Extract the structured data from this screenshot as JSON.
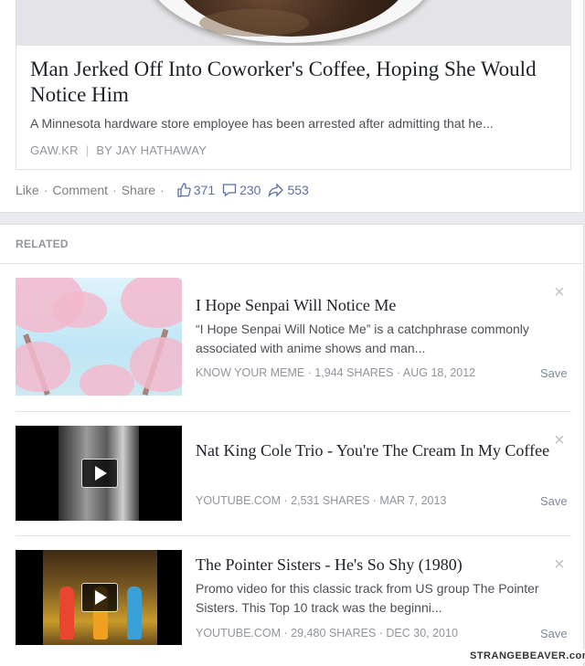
{
  "post": {
    "headline": "Man Jerked Off Into Coworker's Coffee, Hoping She Would Notice Him",
    "description": "A Minnesota hardware store employee has been arrested after admitting that he...",
    "source": "GAW.KR",
    "separator": "|",
    "author": "BY JAY HATHAWAY",
    "actions": {
      "like": "Like",
      "comment": "Comment",
      "share": "Share",
      "dot": "·"
    },
    "counts": {
      "likes": "371",
      "comments": "230",
      "shares": "553"
    }
  },
  "related": {
    "title": "RELATED",
    "save_label": "Save",
    "close_glyph": "×",
    "items": [
      {
        "title": "I Hope Senpai Will Notice Me",
        "description": "“I Hope Senpai Will Notice Me” is a catchphrase commonly associated with anime shows and man...",
        "meta": "KNOW YOUR MEME · 1,944 SHARES · AUG 18, 2012"
      },
      {
        "title": "Nat King Cole Trio - You're The Cream In My Coffee",
        "description": "",
        "meta": "YOUTUBE.COM · 2,531 SHARES · MAR 7, 2013"
      },
      {
        "title": "The Pointer Sisters - He's So Shy (1980)",
        "description": "Promo video for this classic track from US group The Pointer Sisters. This Top 10 track was the beginni...",
        "meta": "YOUTUBE.COM · 29,480 SHARES · DEC 30, 2010"
      }
    ]
  },
  "icons": {
    "like": "thumbs-up-icon",
    "comment": "comment-icon",
    "share": "share-arrow-icon",
    "play": "play-icon",
    "close": "close-icon"
  },
  "watermark": "STRANGEBEAVER.com"
}
